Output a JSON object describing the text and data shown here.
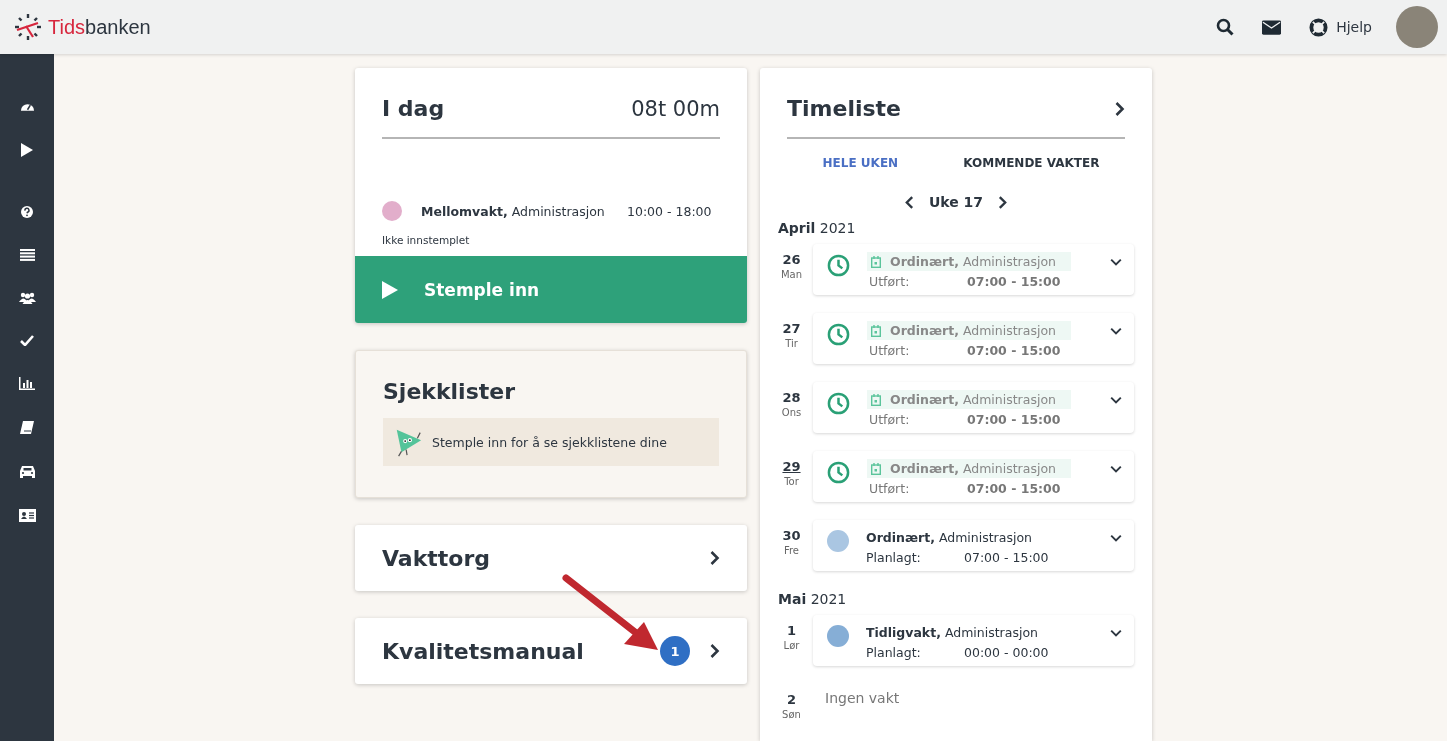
{
  "header": {
    "brand": [
      "Tids",
      "banken"
    ],
    "help_label": "Hjelp"
  },
  "today_card": {
    "title": "I dag",
    "total": "08t 00m",
    "shift": {
      "type": "Mellomvakt,",
      "department": "Administrasjon",
      "time": "10:00 - 18:00",
      "color": "#e2aecb"
    },
    "status": "Ikke innstemplet",
    "button": "Stemple inn"
  },
  "checklist_card": {
    "title": "Sjekklister",
    "message": "Stemple inn for å se sjekklistene dine"
  },
  "link_cards": [
    {
      "title": "Vakttorg"
    },
    {
      "title": "Kvalitetsmanual",
      "badge": "1"
    }
  ],
  "timesheet": {
    "title": "Timeliste",
    "tabs": [
      {
        "label": "HELE UKEN",
        "selected": true
      },
      {
        "label": "KOMMENDE VAKTER",
        "selected": false
      }
    ],
    "week": "Uke 17",
    "months": [
      {
        "name": "April",
        "year": "2021",
        "days": [
          {
            "date": "26",
            "weekday": "Man",
            "today": false,
            "kind": "done",
            "type": "Ordinært,",
            "department": "Administrasjon",
            "status": "Utført:",
            "time": "07:00 - 15:00"
          },
          {
            "date": "27",
            "weekday": "Tir",
            "today": false,
            "kind": "done",
            "type": "Ordinært,",
            "department": "Administrasjon",
            "status": "Utført:",
            "time": "07:00 - 15:00"
          },
          {
            "date": "28",
            "weekday": "Ons",
            "today": false,
            "kind": "done",
            "type": "Ordinært,",
            "department": "Administrasjon",
            "status": "Utført:",
            "time": "07:00 - 15:00"
          },
          {
            "date": "29",
            "weekday": "Tor",
            "today": true,
            "kind": "done",
            "type": "Ordinært,",
            "department": "Administrasjon",
            "status": "Utført:",
            "time": "07:00 - 15:00"
          },
          {
            "date": "30",
            "weekday": "Fre",
            "today": false,
            "kind": "planned",
            "color": "#aac6e2",
            "type": "Ordinært,",
            "department": "Administrasjon",
            "status": "Planlagt:",
            "time": "07:00 - 15:00"
          }
        ]
      },
      {
        "name": "Mai",
        "year": "2021",
        "days": [
          {
            "date": "1",
            "weekday": "Lør",
            "today": false,
            "kind": "planned",
            "color": "#86aed6",
            "type": "Tidligvakt,",
            "department": "Administrasjon",
            "status": "Planlagt:",
            "time": "00:00 - 00:00"
          },
          {
            "date": "2",
            "weekday": "Søn",
            "today": false,
            "kind": "none",
            "text": "Ingen vakt"
          }
        ]
      }
    ]
  }
}
